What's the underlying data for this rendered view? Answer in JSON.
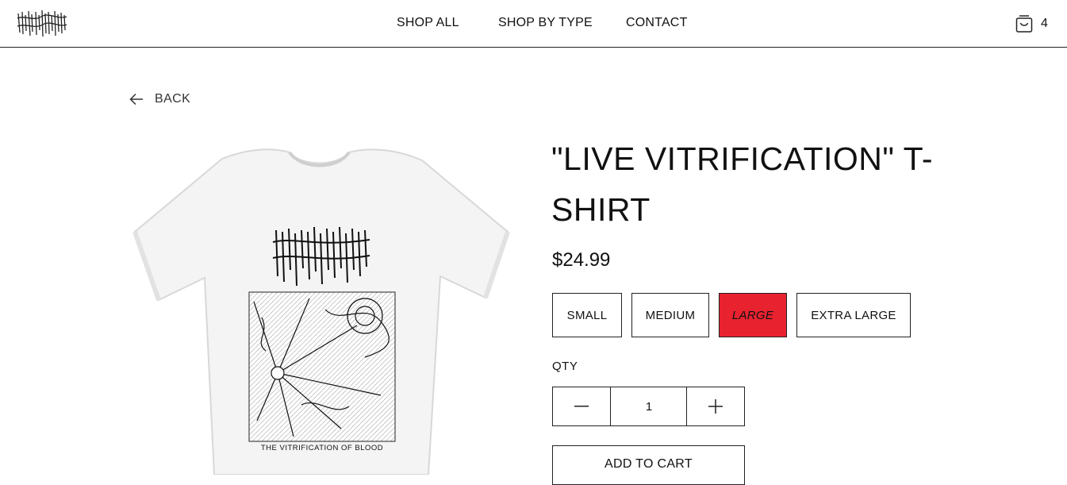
{
  "header": {
    "logo_alt": "band logo",
    "nav": [
      {
        "label": "SHOP ALL"
      },
      {
        "label": "SHOP BY TYPE"
      },
      {
        "label": "CONTACT"
      }
    ],
    "cart_count": "4"
  },
  "back_label": "BACK",
  "product": {
    "title": "\"LIVE VITRIFICATION\" T-SHIRT",
    "price": "$24.99",
    "sizes": [
      {
        "label": "SMALL",
        "selected": false
      },
      {
        "label": "MEDIUM",
        "selected": false
      },
      {
        "label": "LARGE",
        "selected": true
      },
      {
        "label": "EXTRA LARGE",
        "selected": false
      }
    ],
    "qty_label": "QTY",
    "qty_value": "1",
    "add_to_cart_label": "ADD TO CART",
    "shirt_print_caption": "THE VITRIFICATION OF BLOOD"
  },
  "colors": {
    "selected_size_bg": "#e8222f",
    "border": "#222222"
  }
}
